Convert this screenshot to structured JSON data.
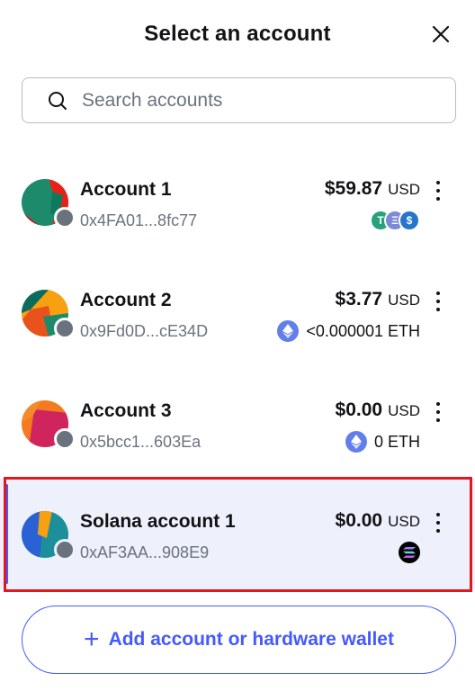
{
  "header": {
    "title": "Select an account"
  },
  "search": {
    "placeholder": "Search accounts"
  },
  "accounts": [
    {
      "name": "Account 1",
      "address": "0x4FA01...8fc77",
      "balance": "$59.87",
      "currency": "USD",
      "token_text": ""
    },
    {
      "name": "Account 2",
      "address": "0x9Fd0D...cE34D",
      "balance": "$3.77",
      "currency": "USD",
      "token_text": "<0.000001 ETH"
    },
    {
      "name": "Account 3",
      "address": "0x5bcc1...603Ea",
      "balance": "$0.00",
      "currency": "USD",
      "token_text": "0 ETH"
    },
    {
      "name": "Solana account 1",
      "address": "0xAF3AA...908E9",
      "balance": "$0.00",
      "currency": "USD",
      "token_text": ""
    }
  ],
  "selected_index": 3,
  "add_button": {
    "label": "Add account or hardware wallet",
    "icon": "plus-icon"
  },
  "colors": {
    "accent": "#4459ff",
    "selected_bg": "#eef0fc",
    "highlight_border": "#e0191e",
    "muted_text": "#6a737d"
  }
}
